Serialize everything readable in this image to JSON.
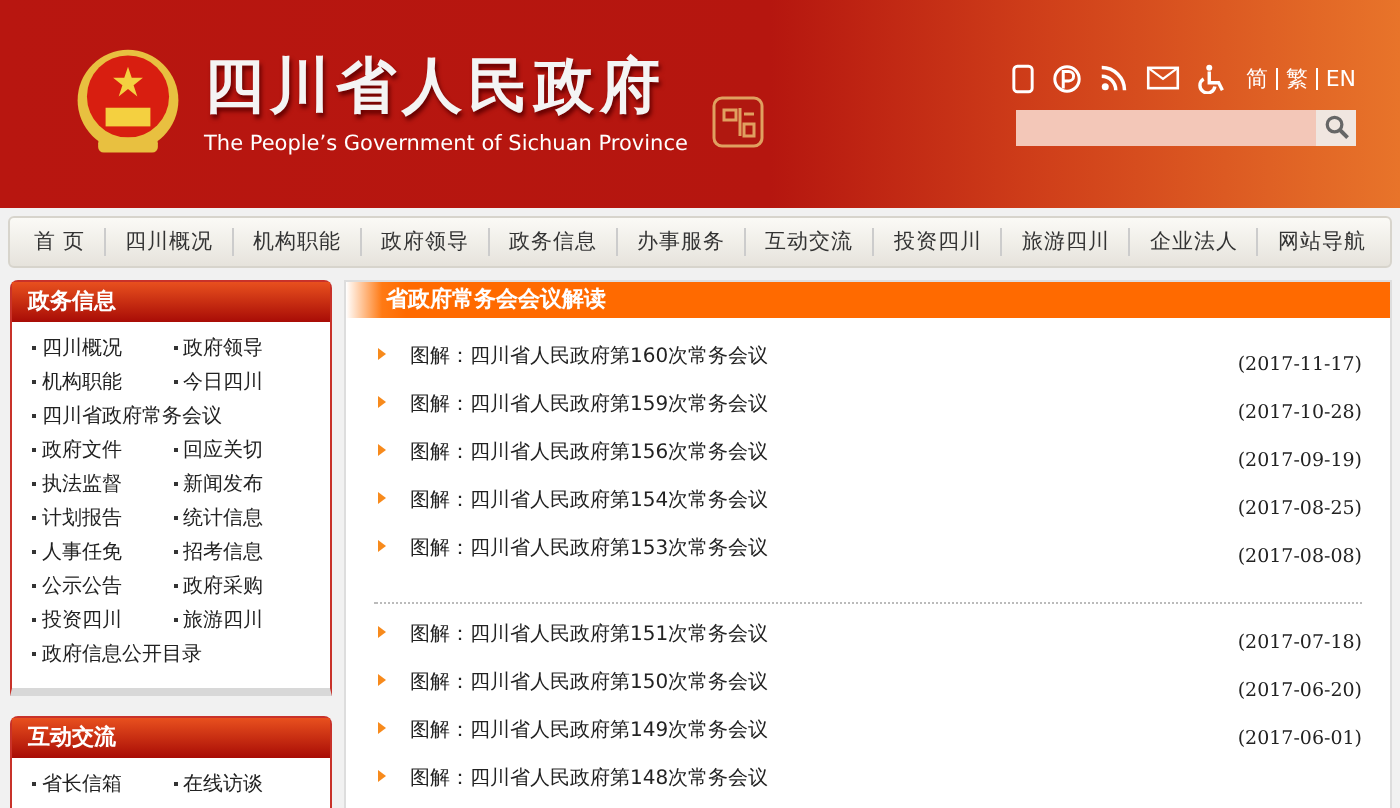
{
  "header": {
    "title": "四川省人民政府",
    "subtitle": "The People’s Government of Sichuan Province",
    "languages": [
      "简",
      "繁",
      "EN"
    ]
  },
  "nav": [
    "首 页",
    "四川概况",
    "机构职能",
    "政府领导",
    "政务信息",
    "办事服务",
    "互动交流",
    "投资四川",
    "旅游四川",
    "企业法人",
    "网站导航"
  ],
  "sidebar": [
    {
      "title": "政务信息",
      "items": [
        {
          "label": "四川概况",
          "kind": "half"
        },
        {
          "label": "政府领导",
          "kind": "half"
        },
        {
          "label": "机构职能",
          "kind": "half"
        },
        {
          "label": "今日四川",
          "kind": "half"
        },
        {
          "label": "四川省政府常务会议",
          "kind": "wide"
        },
        {
          "label": "政府文件",
          "kind": "half"
        },
        {
          "label": "回应关切",
          "kind": "half"
        },
        {
          "label": "执法监督",
          "kind": "half"
        },
        {
          "label": "新闻发布",
          "kind": "half"
        },
        {
          "label": "计划报告",
          "kind": "half"
        },
        {
          "label": "统计信息",
          "kind": "half"
        },
        {
          "label": "人事任免",
          "kind": "half"
        },
        {
          "label": "招考信息",
          "kind": "half"
        },
        {
          "label": "公示公告",
          "kind": "half"
        },
        {
          "label": "政府采购",
          "kind": "half"
        },
        {
          "label": "投资四川",
          "kind": "half"
        },
        {
          "label": "旅游四川",
          "kind": "half"
        },
        {
          "label": "政府信息公开目录",
          "kind": "wide"
        }
      ]
    },
    {
      "title": "互动交流",
      "items": [
        {
          "label": "省长信箱",
          "kind": "half"
        },
        {
          "label": "在线访谈",
          "kind": "half"
        }
      ]
    }
  ],
  "main": {
    "title": "省政府常务会会议解读",
    "groups": [
      [
        {
          "title": "图解：四川省人民政府第160次常务会议",
          "date": "(2017-11-17)"
        },
        {
          "title": "图解：四川省人民政府第159次常务会议",
          "date": "(2017-10-28)"
        },
        {
          "title": "图解：四川省人民政府第156次常务会议",
          "date": "(2017-09-19)"
        },
        {
          "title": "图解：四川省人民政府第154次常务会议",
          "date": "(2017-08-25)"
        },
        {
          "title": "图解：四川省人民政府第153次常务会议",
          "date": "(2017-08-08)"
        }
      ],
      [
        {
          "title": "图解：四川省人民政府第151次常务会议",
          "date": "(2017-07-18)"
        },
        {
          "title": "图解：四川省人民政府第150次常务会议",
          "date": "(2017-06-20)"
        },
        {
          "title": "图解：四川省人民政府第149次常务会议",
          "date": "(2017-06-01)"
        },
        {
          "title": "图解：四川省人民政府第148次常务会议"
        }
      ]
    ]
  }
}
